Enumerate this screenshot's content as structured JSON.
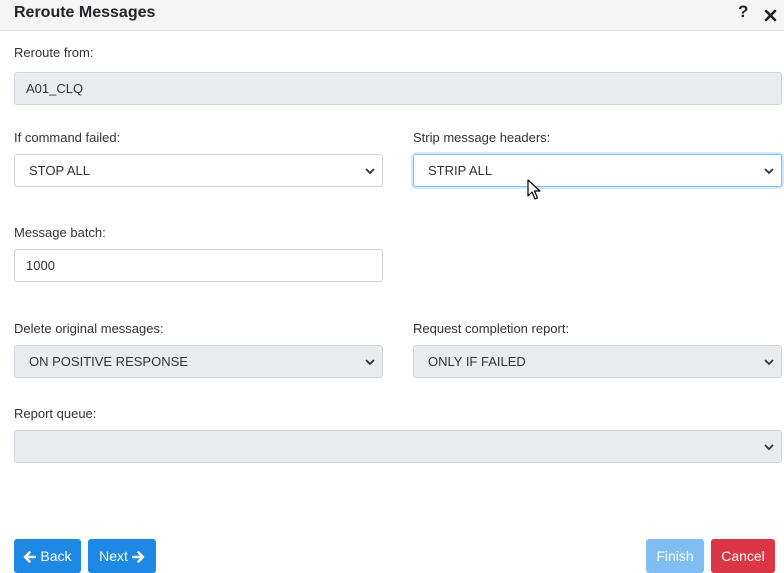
{
  "dialog": {
    "title": "Reroute Messages"
  },
  "icons": {
    "help": "?",
    "close": "✕"
  },
  "form": {
    "reroute_from": {
      "label": "Reroute from:",
      "value": "A01_CLQ"
    },
    "if_command_failed": {
      "label": "If command failed:",
      "value": "STOP ALL"
    },
    "strip_message_headers": {
      "label": "Strip message headers:",
      "value": "STRIP ALL"
    },
    "message_batch": {
      "label": "Message batch:",
      "value": "1000"
    },
    "delete_original_messages": {
      "label": "Delete original messages:",
      "value": "ON POSITIVE RESPONSE"
    },
    "request_completion_report": {
      "label": "Request completion report:",
      "value": "ONLY IF FAILED"
    },
    "report_queue": {
      "label": "Report queue:",
      "value": ""
    }
  },
  "buttons": {
    "back": "Back",
    "next": "Next",
    "finish": "Finish",
    "cancel": "Cancel"
  },
  "colors": {
    "primary": "#1e88e5",
    "primary_disabled": "#7fbdf2",
    "danger": "#dc3545",
    "readonly_bg": "#e9ecef"
  }
}
